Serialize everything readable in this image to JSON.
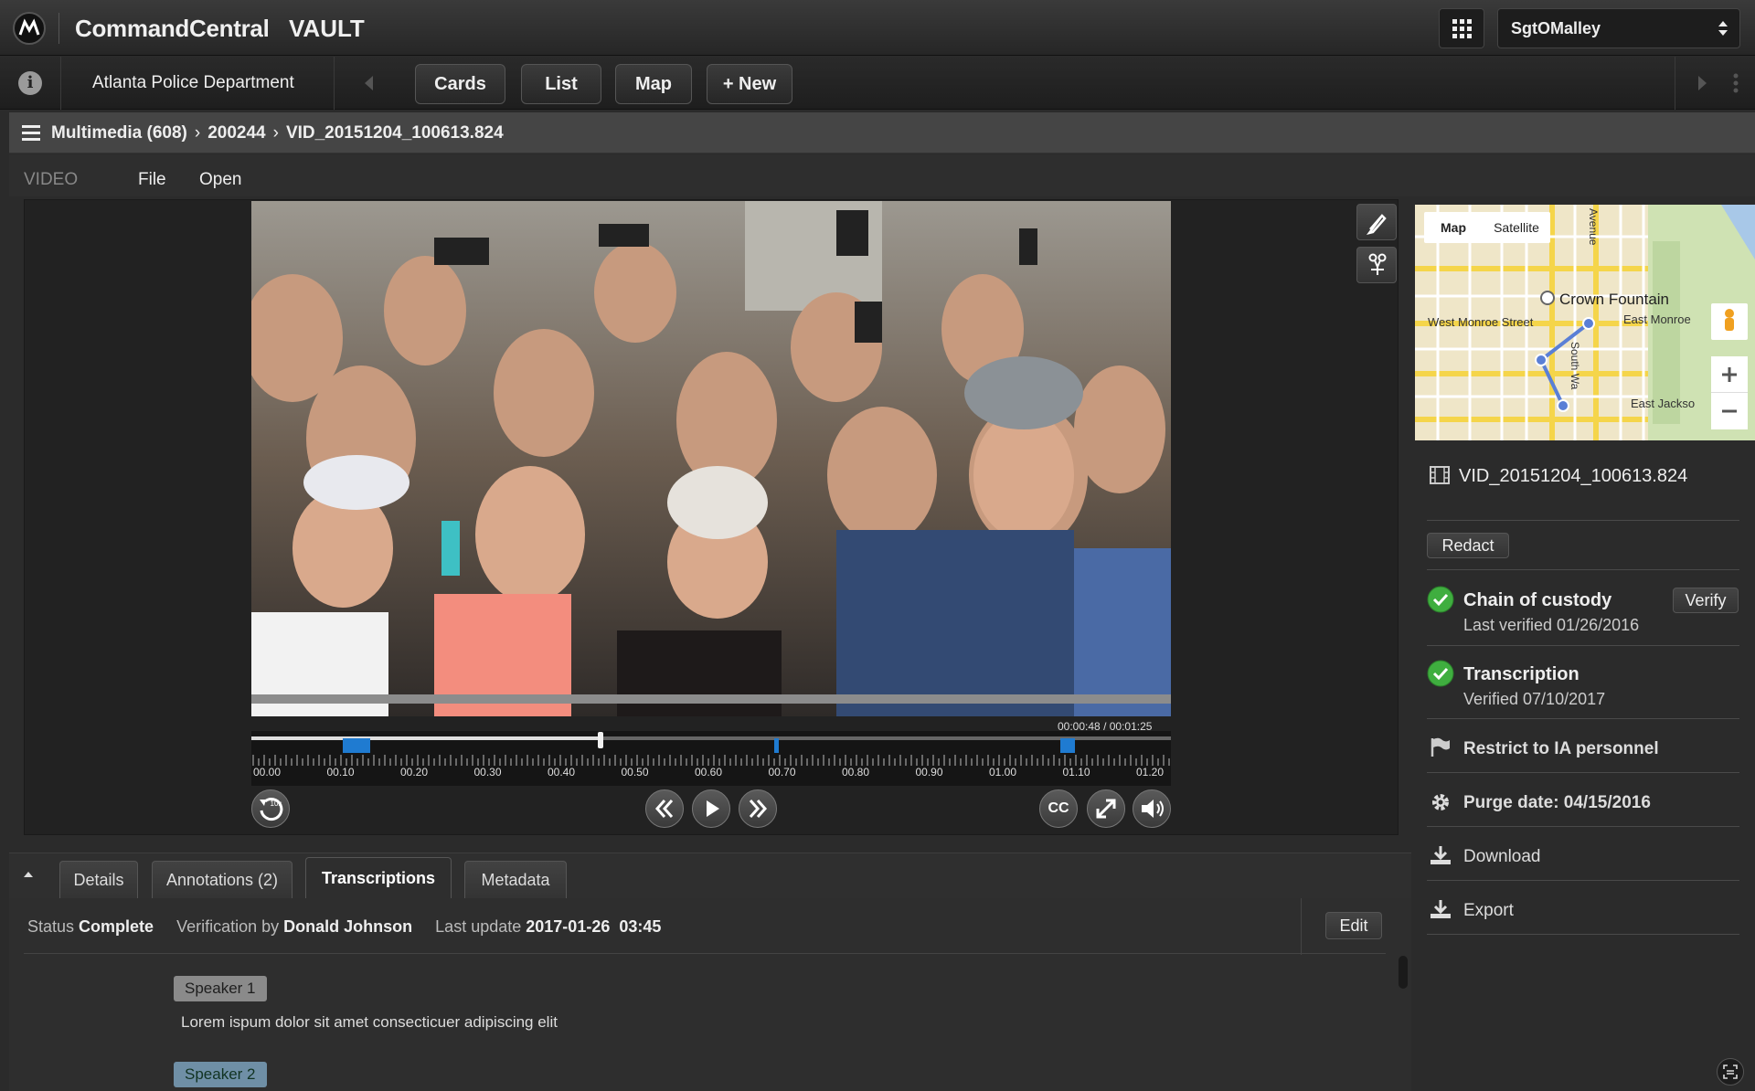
{
  "header": {
    "brand": "CommandCentral",
    "product": "VAULT",
    "user": "SgtOMalley",
    "icons": {
      "logo": "motorola-logo-icon",
      "apps": "app-grid-icon",
      "user_select": "updown-chevron-icon"
    }
  },
  "nav": {
    "department": "Atlanta Police Department",
    "buttons": [
      "Cards",
      "List",
      "Map",
      "+ New"
    ],
    "icons": {
      "info": "info-icon",
      "prev": "chevron-left-icon",
      "next": "chevron-right-icon",
      "more": "more-vertical-icon"
    }
  },
  "breadcrumb": {
    "items": [
      "Multimedia (608)",
      "200244",
      "VID_20151204_100613.824"
    ],
    "separator": "›",
    "menu_icon": "hamburger-icon"
  },
  "menu": {
    "label": "VIDEO",
    "items": [
      "File",
      "Open"
    ]
  },
  "player": {
    "elapsed": "00:00:48",
    "total": "00:01:25",
    "time_separator": "/",
    "playhead_fraction": 0.38,
    "tick_labels": [
      "00.00",
      "00.10",
      "00.20",
      "00.30",
      "00.40",
      "00.50",
      "00.60",
      "00.70",
      "00.80",
      "00.90",
      "01.00",
      "01.10",
      "01.20"
    ],
    "replay_label": "10s",
    "cc_label": "CC",
    "icons": [
      "replay-10s-icon",
      "rewind-icon",
      "play-icon",
      "fast-forward-icon",
      "closed-captions-icon",
      "fullscreen-icon",
      "volume-icon"
    ],
    "tools": [
      "edit-pencil-icon",
      "cut-scissors-icon"
    ],
    "accent_color": "#1f7bd1"
  },
  "map": {
    "tabs": [
      "Map",
      "Satellite"
    ],
    "labels": [
      "Crown Fountain",
      "West Monroe Street",
      "East Monroe",
      "East Jackso",
      "Avenue",
      "South Wa"
    ],
    "route_color": "#5a7fd6",
    "icons": {
      "person": "street-view-person-icon",
      "zoom_in": "plus-icon",
      "zoom_out": "minus-icon"
    }
  },
  "details": {
    "filename": "VID_20151204_100613.824",
    "file_icon": "film-icon",
    "redact_label": "Redact",
    "chain": {
      "title": "Chain of custody",
      "sub": "Last verified 01/26/2016",
      "button": "Verify"
    },
    "transcription": {
      "title": "Transcription",
      "sub": "Verified 07/10/2017"
    },
    "restrict": "Restrict to IA personnel",
    "purge": "Purge date: 04/15/2016",
    "download": "Download",
    "export": "Export",
    "ok_color": "#3fae3f"
  },
  "tabs": {
    "collapse_icon": "caret-up-icon",
    "items": [
      "Details",
      "Annotations (2)",
      "Transcriptions",
      "Metadata"
    ],
    "active": "Transcriptions"
  },
  "transcript": {
    "status_label": "Status",
    "status": "Complete",
    "verification_label": "Verification by",
    "verifier": "Donald Johnson",
    "update_label": "Last update",
    "update": "2017-01-26  03:45",
    "edit_label": "Edit",
    "speakers": [
      {
        "name": "Speaker 1",
        "text": "Lorem ispum dolor sit amet consecticuer adipiscing elit"
      },
      {
        "name": "Speaker 2",
        "text": ""
      }
    ]
  }
}
